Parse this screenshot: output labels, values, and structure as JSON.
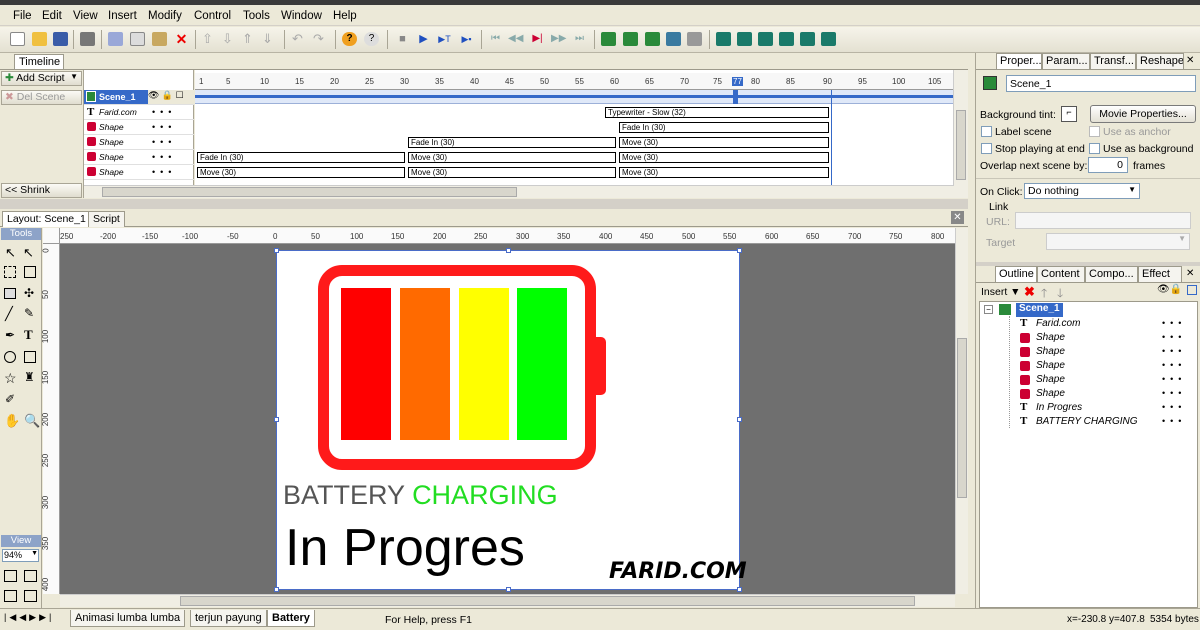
{
  "menu": {
    "items": [
      "File",
      "Edit",
      "View",
      "Insert",
      "Modify",
      "Control",
      "Tools",
      "Window",
      "Help"
    ]
  },
  "timeline": {
    "tab_label": "Timeline",
    "add_script_label": "Add Script",
    "del_scene_label": "Del Scene",
    "shrink_label": "<< Shrink",
    "ruler_ticks": [
      "1",
      "5",
      "10",
      "15",
      "20",
      "25",
      "30",
      "35",
      "40",
      "45",
      "50",
      "55",
      "60",
      "65",
      "70",
      "75",
      "77",
      "80",
      "85",
      "90",
      "95",
      "100",
      "105"
    ],
    "rows": [
      {
        "name": "Scene_1",
        "type": "scene"
      },
      {
        "name": "Farid.com",
        "type": "text"
      },
      {
        "name": "Shape",
        "type": "shape"
      },
      {
        "name": "Shape",
        "type": "shape"
      },
      {
        "name": "Shape",
        "type": "shape"
      },
      {
        "name": "Shape",
        "type": "shape"
      }
    ],
    "effects": {
      "typewriter": "Typewriter - Slow (32)",
      "fade_in_1": "Fade In (30)",
      "move_1": "Move (30)",
      "fade_in_2": "Fade In (30)",
      "move_2": "Move (30)",
      "move_3": "Move (30)",
      "fade_in_3": "Fade In (30)",
      "move_4": "Move (30)",
      "move_5": "Move (30)",
      "move_6": "Move (30)"
    }
  },
  "layout": {
    "tab_layout": "Layout: Scene_1",
    "tab_script": "Script",
    "tools_label": "Tools",
    "view_label": "View",
    "zoom": "94%",
    "hruler_ticks": [
      "250",
      "-200",
      "-150",
      "-100",
      "-50",
      "0",
      "50",
      "100",
      "150",
      "200",
      "250",
      "300",
      "350",
      "400",
      "450",
      "500",
      "550",
      "600",
      "650",
      "700",
      "750",
      "800"
    ],
    "vruler_ticks": [
      "0",
      "50",
      "100",
      "150",
      "200",
      "250",
      "300",
      "350",
      "400"
    ]
  },
  "stage": {
    "headline_part1": "BATTERY",
    "headline_part2": "CHARGING",
    "subtitle": "In Progres",
    "signature": "FARID.COM",
    "colors": {
      "battery_frame": "#ff1a1a",
      "bar1": "#ff0000",
      "bar2": "#ff6a00",
      "bar3": "#ffff00",
      "bar4": "#00ff00",
      "battery_text": "#555555",
      "charging_text": "#22dd22"
    }
  },
  "status": {
    "sheets": [
      "Animasi lumba lumba",
      "terjun payung",
      "Battery"
    ],
    "help": "For Help, press F1",
    "coords": "x=-230.8 y=407.8",
    "size": "5354 bytes"
  },
  "properties": {
    "tabs": [
      "Proper...",
      "Param...",
      "Transf...",
      "Reshape"
    ],
    "scene_name": "Scene_1",
    "background_tint_label": "Background tint:",
    "movie_properties_label": "Movie Properties...",
    "label_scene": "Label scene",
    "use_as_anchor": "Use as anchor",
    "stop_playing": "Stop playing at end",
    "use_as_background": "Use as background",
    "overlap_label": "Overlap next scene by:",
    "overlap_value": "0",
    "frames_label": "frames",
    "on_click_label": "On Click:",
    "on_click_value": "Do nothing",
    "link_label": "Link",
    "url_label": "URL:",
    "target_label": "Target"
  },
  "outline": {
    "tabs": [
      "Outline",
      "Content",
      "Compo...",
      "Effect"
    ],
    "insert_label": "Insert",
    "items": [
      {
        "name": "Scene_1",
        "type": "scene"
      },
      {
        "name": "Farid.com",
        "type": "text"
      },
      {
        "name": "Shape",
        "type": "shape"
      },
      {
        "name": "Shape",
        "type": "shape"
      },
      {
        "name": "Shape",
        "type": "shape"
      },
      {
        "name": "Shape",
        "type": "shape"
      },
      {
        "name": "Shape",
        "type": "shape"
      },
      {
        "name": "In Progres",
        "type": "text"
      },
      {
        "name": "BATTERY CHARGING",
        "type": "text"
      }
    ]
  }
}
